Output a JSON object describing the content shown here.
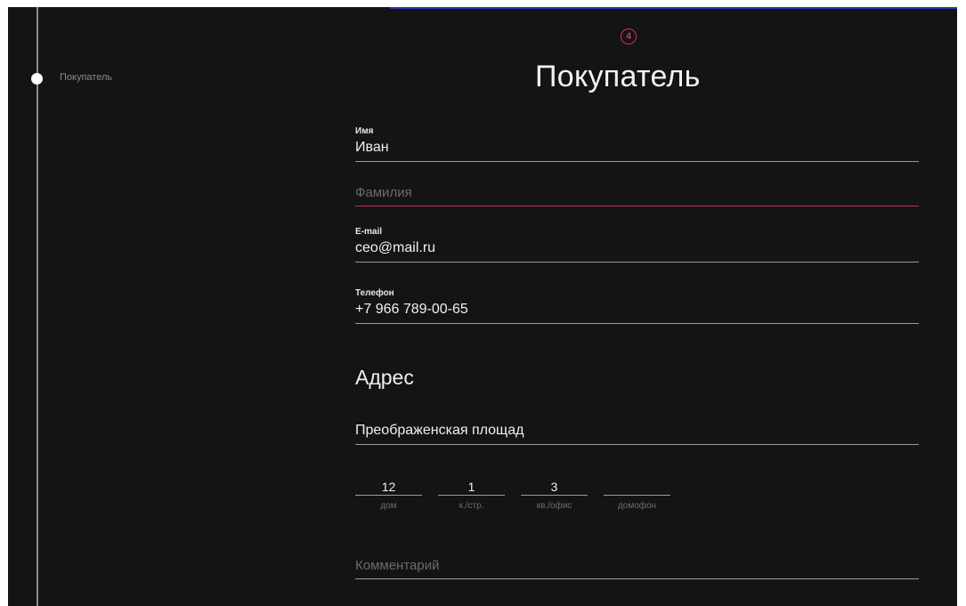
{
  "sidebar": {
    "steps": [
      {
        "label": "Покупатель",
        "active": true
      }
    ]
  },
  "header": {
    "step_number": "4",
    "title": "Покупатель"
  },
  "form": {
    "first_name": {
      "label": "Имя",
      "value": "Иван"
    },
    "last_name": {
      "placeholder": "Фамилия",
      "state": "error"
    },
    "email": {
      "label": "E-mail",
      "value": "ceo@mail.ru"
    },
    "phone": {
      "label": "Телефон",
      "value": "+7 966 789-00-65"
    }
  },
  "address": {
    "title": "Адрес",
    "street": {
      "value": "Преображенская площад"
    },
    "house": {
      "value": "12",
      "label": "дом"
    },
    "building": {
      "value": "1",
      "label": "к./стр."
    },
    "apartment": {
      "value": "3",
      "label": "кв./офис"
    },
    "intercom": {
      "value": "",
      "label": "домофон"
    },
    "comment": {
      "placeholder": "Комментарий"
    }
  },
  "colors": {
    "background": "#141414",
    "accent": "#d0335a",
    "text": "#f0f0f0",
    "muted": "#6b6b6b"
  }
}
